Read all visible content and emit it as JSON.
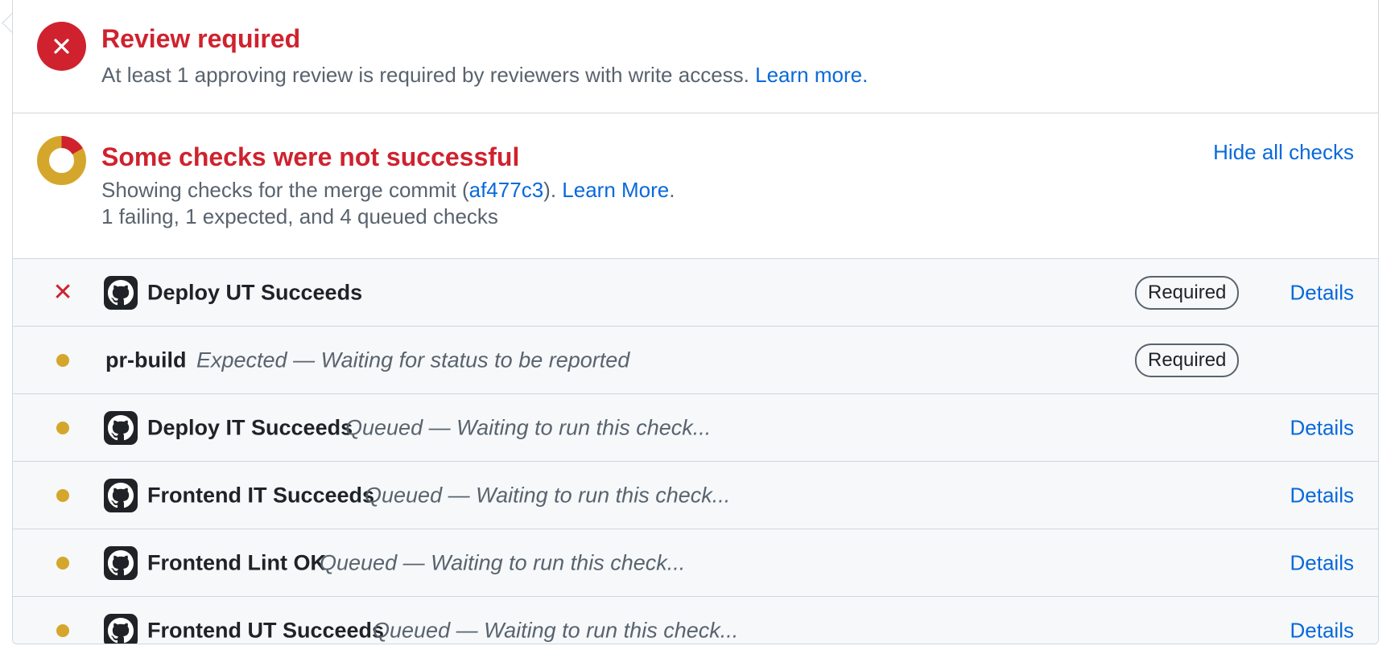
{
  "review": {
    "title": "Review required",
    "description": "At least 1 approving review is required by reviewers with write access.",
    "learn_more": "Learn more."
  },
  "checks": {
    "title": "Some checks were not successful",
    "hide_label": "Hide all checks",
    "summary_prefix": "Showing checks for the merge commit (",
    "commit": "af477c3",
    "summary_mid": ").",
    "learn_more": "Learn More",
    "summary_suffix": ".",
    "counts": "1 failing, 1 expected, and 4 queued checks"
  },
  "colors": {
    "failure": "#cf222e",
    "pending": "#d4a72c",
    "link": "#0969da"
  },
  "rows": [
    {
      "state": "failure",
      "icon": "github-icon",
      "name": "Deploy UT Succeeds",
      "description": "",
      "required": "Required",
      "details": "Details"
    },
    {
      "state": "pending",
      "icon": "",
      "name": "pr-build",
      "description": "Expected — Waiting for status to be reported",
      "required": "Required",
      "details": ""
    },
    {
      "state": "pending",
      "icon": "github-icon",
      "name": "Deploy IT Succeeds",
      "description": "Queued — Waiting to run this check...",
      "required": "",
      "details": "Details"
    },
    {
      "state": "pending",
      "icon": "github-icon",
      "name": "Frontend IT Succeeds",
      "description": "Queued — Waiting to run this check...",
      "required": "",
      "details": "Details"
    },
    {
      "state": "pending",
      "icon": "github-icon",
      "name": "Frontend Lint OK",
      "description": "Queued — Waiting to run this check...",
      "required": "",
      "details": "Details"
    },
    {
      "state": "pending",
      "icon": "github-icon",
      "name": "Frontend UT Succeeds",
      "description": "Queued — Waiting to run this check...",
      "required": "",
      "details": "Details"
    }
  ]
}
